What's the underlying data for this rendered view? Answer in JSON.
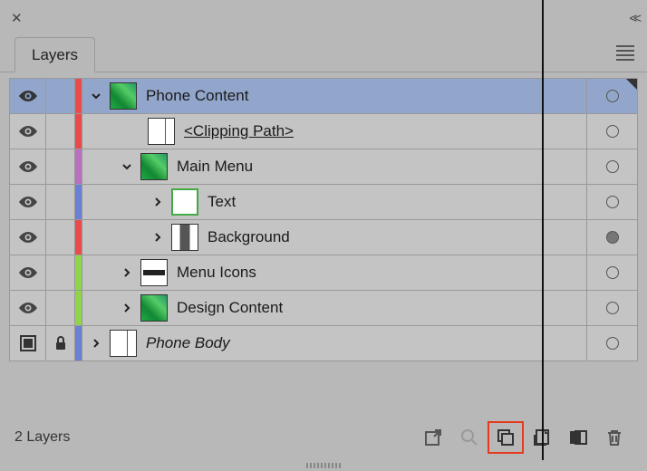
{
  "panel": {
    "tab_label": "Layers",
    "footer_count": "2 Layers"
  },
  "layers": [
    {
      "label": "Phone Content",
      "underline": false,
      "italic": false
    },
    {
      "label": "<Clipping Path>",
      "underline": true,
      "italic": false
    },
    {
      "label": "Main Menu",
      "underline": false,
      "italic": false
    },
    {
      "label": "Text",
      "underline": false,
      "italic": false
    },
    {
      "label": "Background",
      "underline": false,
      "italic": false
    },
    {
      "label": "Menu Icons",
      "underline": false,
      "italic": false
    },
    {
      "label": "Design Content",
      "underline": false,
      "italic": false
    },
    {
      "label": "Phone Body",
      "underline": false,
      "italic": true
    }
  ],
  "colors": {
    "red": "#e94b4b",
    "purple": "#b96fc2",
    "blue": "#6a7fd6",
    "green": "#8fd44a"
  }
}
